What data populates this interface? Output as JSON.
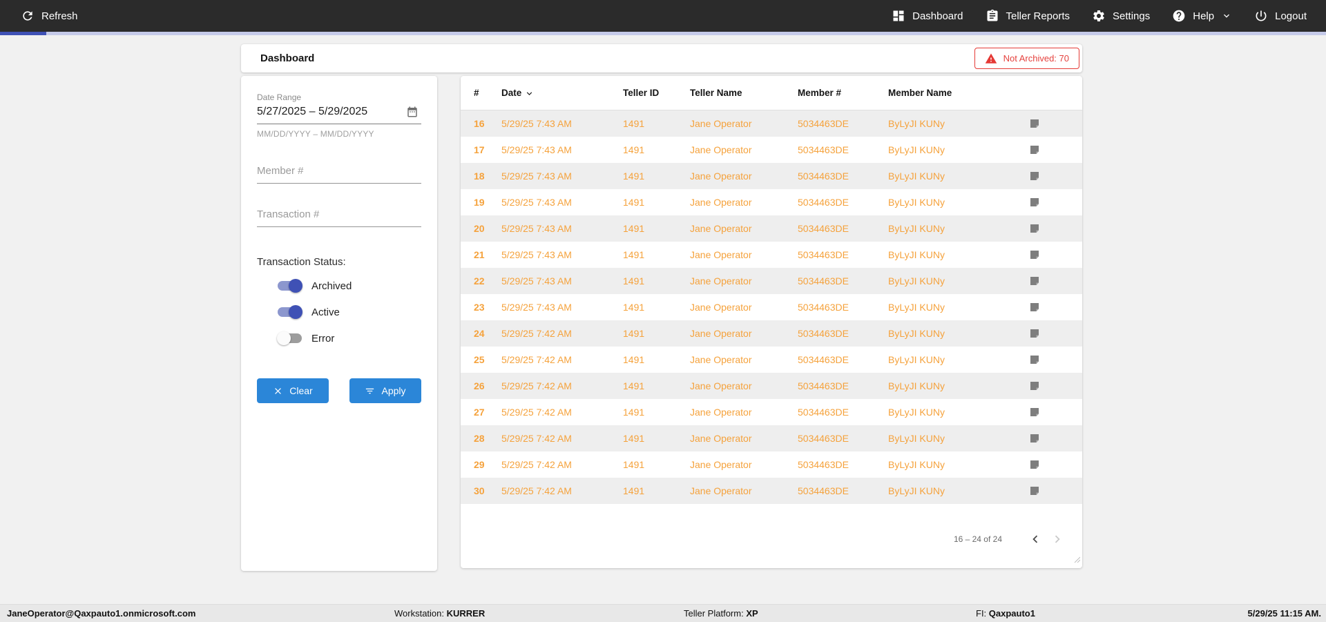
{
  "colors": {
    "nav_bg": "#2b2b2b",
    "progress_value": "#3f51b5",
    "progress_track": "#c5cae9",
    "accent_blue": "#2b86d8",
    "toggle_on": "#3f51b5",
    "alert_red": "#e53935",
    "row_text_orange": "#f5a23c",
    "row_alt_bg": "#eeeeee"
  },
  "topnav": {
    "refresh_label": "Refresh",
    "items": [
      {
        "label": "Dashboard",
        "icon": "dashboard-icon"
      },
      {
        "label": "Teller Reports",
        "icon": "clipboard-icon"
      },
      {
        "label": "Settings",
        "icon": "gear-icon"
      },
      {
        "label": "Help",
        "icon": "help-icon"
      },
      {
        "label": "Logout",
        "icon": "power-icon"
      }
    ]
  },
  "header": {
    "title": "Dashboard",
    "badge": {
      "text": "Not Archived: 70"
    }
  },
  "filters": {
    "date_range": {
      "label": "Date Range",
      "value": "5/27/2025 – 5/29/2025",
      "hint": "MM/DD/YYYY – MM/DD/YYYY"
    },
    "member_placeholder": "Member #",
    "transaction_placeholder": "Transaction #",
    "status_label": "Transaction Status:",
    "toggles": [
      {
        "label": "Archived",
        "on": true
      },
      {
        "label": "Active",
        "on": true
      },
      {
        "label": "Error",
        "on": false
      }
    ],
    "clear_label": "Clear",
    "apply_label": "Apply"
  },
  "table": {
    "columns": [
      "#",
      "Date",
      "Teller ID",
      "Teller Name",
      "Member #",
      "Member Name"
    ],
    "sorted_by": "Date",
    "rows": [
      {
        "num": "16",
        "date": "5/29/25 7:43 AM",
        "teller_id": "1491",
        "teller_name": "Jane Operator",
        "member_num": "5034463DE",
        "member_name": "ByLyJI KUNy"
      },
      {
        "num": "17",
        "date": "5/29/25 7:43 AM",
        "teller_id": "1491",
        "teller_name": "Jane Operator",
        "member_num": "5034463DE",
        "member_name": "ByLyJI KUNy"
      },
      {
        "num": "18",
        "date": "5/29/25 7:43 AM",
        "teller_id": "1491",
        "teller_name": "Jane Operator",
        "member_num": "5034463DE",
        "member_name": "ByLyJI KUNy"
      },
      {
        "num": "19",
        "date": "5/29/25 7:43 AM",
        "teller_id": "1491",
        "teller_name": "Jane Operator",
        "member_num": "5034463DE",
        "member_name": "ByLyJI KUNy"
      },
      {
        "num": "20",
        "date": "5/29/25 7:43 AM",
        "teller_id": "1491",
        "teller_name": "Jane Operator",
        "member_num": "5034463DE",
        "member_name": "ByLyJI KUNy"
      },
      {
        "num": "21",
        "date": "5/29/25 7:43 AM",
        "teller_id": "1491",
        "teller_name": "Jane Operator",
        "member_num": "5034463DE",
        "member_name": "ByLyJI KUNy"
      },
      {
        "num": "22",
        "date": "5/29/25 7:43 AM",
        "teller_id": "1491",
        "teller_name": "Jane Operator",
        "member_num": "5034463DE",
        "member_name": "ByLyJI KUNy"
      },
      {
        "num": "23",
        "date": "5/29/25 7:43 AM",
        "teller_id": "1491",
        "teller_name": "Jane Operator",
        "member_num": "5034463DE",
        "member_name": "ByLyJI KUNy"
      },
      {
        "num": "24",
        "date": "5/29/25 7:42 AM",
        "teller_id": "1491",
        "teller_name": "Jane Operator",
        "member_num": "5034463DE",
        "member_name": "ByLyJI KUNy"
      },
      {
        "num": "25",
        "date": "5/29/25 7:42 AM",
        "teller_id": "1491",
        "teller_name": "Jane Operator",
        "member_num": "5034463DE",
        "member_name": "ByLyJI KUNy"
      },
      {
        "num": "26",
        "date": "5/29/25 7:42 AM",
        "teller_id": "1491",
        "teller_name": "Jane Operator",
        "member_num": "5034463DE",
        "member_name": "ByLyJI KUNy"
      },
      {
        "num": "27",
        "date": "5/29/25 7:42 AM",
        "teller_id": "1491",
        "teller_name": "Jane Operator",
        "member_num": "5034463DE",
        "member_name": "ByLyJI KUNy"
      },
      {
        "num": "28",
        "date": "5/29/25 7:42 AM",
        "teller_id": "1491",
        "teller_name": "Jane Operator",
        "member_num": "5034463DE",
        "member_name": "ByLyJI KUNy"
      },
      {
        "num": "29",
        "date": "5/29/25 7:42 AM",
        "teller_id": "1491",
        "teller_name": "Jane Operator",
        "member_num": "5034463DE",
        "member_name": "ByLyJI KUNy"
      },
      {
        "num": "30",
        "date": "5/29/25 7:42 AM",
        "teller_id": "1491",
        "teller_name": "Jane Operator",
        "member_num": "5034463DE",
        "member_name": "ByLyJI KUNy"
      }
    ],
    "pagination": {
      "label": "16 – 24 of 24"
    }
  },
  "statusbar": {
    "user": "JaneOperator@Qaxpauto1.onmicrosoft.com",
    "workstation_label": "Workstation: ",
    "workstation": "KURRER",
    "platform_label": "Teller Platform: ",
    "platform": "XP",
    "fi_label": "FI: ",
    "fi": "Qaxpauto1",
    "datetime": "5/29/25 11:15 AM."
  }
}
